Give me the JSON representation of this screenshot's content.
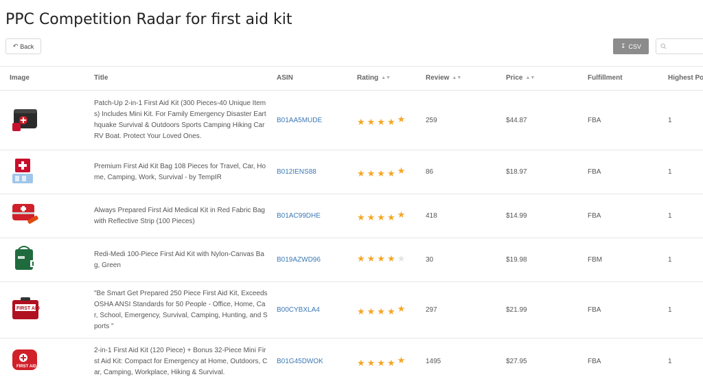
{
  "page": {
    "title": "PPC Competition Radar for first aid kit"
  },
  "toolbar": {
    "back_label": "Back",
    "csv_label": "CSV",
    "search_placeholder": ""
  },
  "table": {
    "columns": [
      "Image",
      "Title",
      "ASIN",
      "Rating",
      "Review",
      "Price",
      "Fulfillment",
      "Highest Po"
    ],
    "rows": [
      {
        "title": "Patch-Up 2-in-1 First Aid Kit (300 Pieces-40 Unique Items) Includes Mini Kit. For Family Emergency Disaster Earthquake Survival & Outdoors Sports Camping Hiking Car RV Boat. Protect Your Loved Ones.",
        "asin": "B01AA5MUDE",
        "rating_stars": 4.5,
        "review": "259",
        "price": "$44.87",
        "fulfillment": "FBA",
        "highest_position": "1"
      },
      {
        "title": "Premium First Aid Kit Bag 108 Pieces for Travel, Car, Home, Camping, Work, Survival - by TempIR",
        "asin": "B012IENS88",
        "rating_stars": 4.5,
        "review": "86",
        "price": "$18.97",
        "fulfillment": "FBA",
        "highest_position": "1"
      },
      {
        "title": "Always Prepared First Aid Medical Kit in Red Fabric Bag with Reflective Strip (100 Pieces)",
        "asin": "B01AC99DHE",
        "rating_stars": 4.5,
        "review": "418",
        "price": "$14.99",
        "fulfillment": "FBA",
        "highest_position": "1"
      },
      {
        "title": "Redi-Medi 100-Piece First Aid Kit with Nylon-Canvas Bag, Green",
        "asin": "B019AZWD96",
        "rating_stars": 4,
        "review": "30",
        "price": "$19.98",
        "fulfillment": "FBM",
        "highest_position": "1"
      },
      {
        "title": "\"Be Smart Get Prepared 250 Piece First Aid Kit, Exceeds OSHA ANSI Standards for 50 People - Office, Home, Car, School, Emergency, Survival, Camping, Hunting, and Sports \"",
        "asin": "B00CYBXLA4",
        "rating_stars": 4.5,
        "review": "297",
        "price": "$21.99",
        "fulfillment": "FBA",
        "highest_position": "1"
      },
      {
        "title": "2-in-1 First Aid Kit (120 Piece) + Bonus 32-Piece Mini First Aid Kit: Compact for Emergency at Home, Outdoors, Car, Camping, Workplace, Hiking & Survival.",
        "asin": "B01G45DWOK",
        "rating_stars": 4.5,
        "review": "1495",
        "price": "$27.95",
        "fulfillment": "FBA",
        "highest_position": "1"
      }
    ]
  }
}
